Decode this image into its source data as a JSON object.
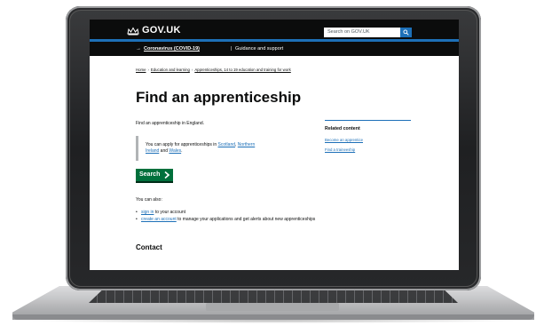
{
  "header": {
    "logo": "GOV.UK",
    "search_placeholder": "Search on GOV.UK"
  },
  "banner": {
    "link": "Coronavirus (COVID-19)",
    "separator": "|",
    "text": "Guidance and support"
  },
  "breadcrumb": [
    "Home",
    "Education and learning",
    "Apprenticeships, 14 to 19 education and training for work"
  ],
  "page": {
    "title": "Find an apprenticeship",
    "intro": "Find an apprenticeship in England.",
    "inset": {
      "prefix": "You can apply for apprenticeships in ",
      "link1": "Scotland",
      "sep": ", ",
      "link2": "Northern Ireland",
      "and": " and ",
      "link3": "Wales",
      "suffix": "."
    },
    "start_button": "Search",
    "you_can_also": "You can also:",
    "list": [
      {
        "link": "sign in",
        "text": " to your account"
      },
      {
        "link": "create an account",
        "text": " to manage your applications and get alerts about new apprenticeships"
      }
    ],
    "contact_heading": "Contact"
  },
  "related": {
    "title": "Related content",
    "links": [
      "Become an apprentice",
      "Find a traineeship"
    ]
  },
  "colors": {
    "header_bg": "#0b0c0c",
    "brand_blue": "#1d70b8",
    "button_green": "#00703c"
  }
}
